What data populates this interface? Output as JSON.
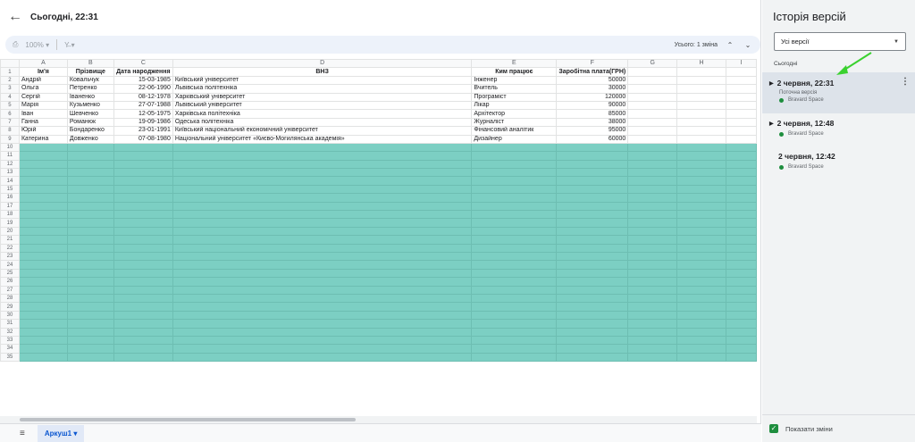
{
  "header": {
    "title": "Сьогодні, 22:31",
    "back_icon": "arrow-left-icon"
  },
  "toolbar": {
    "print_icon": "print-icon",
    "zoom": "100%",
    "format_icon": "format-icon",
    "changes": "Усього: 1 зміна",
    "prev_icon": "chevron-up-icon",
    "next_icon": "chevron-down-icon"
  },
  "sheet": {
    "columns": [
      "A",
      "B",
      "C",
      "D",
      "E",
      "F",
      "G",
      "H",
      "I"
    ],
    "headers": [
      "Ім'я",
      "Прізвище",
      "Дата народження",
      "ВНЗ",
      "Ким працює",
      "Заробітна плата(ГРН)"
    ],
    "rows": [
      [
        "Андрій",
        "Ковальчук",
        "15-03-1985",
        "Київський університет",
        "Інженер",
        "50000"
      ],
      [
        "Ольга",
        "Петренко",
        "22-06-1990",
        "Львівська політехніка",
        "Вчитель",
        "30000"
      ],
      [
        "Сергій",
        "Іваненко",
        "08-12-1978",
        "Харківський університет",
        "Програміст",
        "120000"
      ],
      [
        "Марія",
        "Кузьменко",
        "27-07-1988",
        "Львівський університет",
        "Лікар",
        "90000"
      ],
      [
        "Іван",
        "Шевченко",
        "12-05-1975",
        "Харківська політехніка",
        "Архітектор",
        "85000"
      ],
      [
        "Ганна",
        "Романюк",
        "19-09-1986",
        "Одеська політехніка",
        "Журналіст",
        "38000"
      ],
      [
        "Юрій",
        "Бондаренко",
        "23-01-1991",
        "Київський національний економічний університет",
        "Фінансовий аналітик",
        "95000"
      ],
      [
        "Катерина",
        "Довженко",
        "07-08-1980",
        "Національний університет «Києво-Могилянська академія»",
        "Дизайнер",
        "60000"
      ]
    ],
    "row_numbers": [
      "1",
      "2",
      "3",
      "4",
      "5",
      "6",
      "7",
      "8",
      "9",
      "10",
      "11",
      "12",
      "13",
      "14",
      "15",
      "16",
      "17",
      "18",
      "19",
      "20",
      "21",
      "22",
      "23",
      "24",
      "25",
      "26",
      "27",
      "28",
      "29",
      "30",
      "31",
      "32",
      "33",
      "34",
      "35"
    ],
    "highlight_color": "#7ccfc3"
  },
  "sheetbar": {
    "menu_icon": "hamburger-icon",
    "tab_label": "Аркуш1",
    "tab_caret": "▾"
  },
  "panel": {
    "title": "Історія версій",
    "filter": "Усі версії",
    "group": "Сьогодні",
    "versions": [
      {
        "time": "2 червня, 22:31",
        "note": "Поточна версія",
        "user": "Bravard Space"
      },
      {
        "time": "2 червня, 12:48",
        "user": "Bravard Space"
      },
      {
        "time": "2 червня, 12:42",
        "user": "Bravard Space"
      }
    ],
    "show_changes": "Показати зміни",
    "annotation_color": "#3ad12f"
  }
}
